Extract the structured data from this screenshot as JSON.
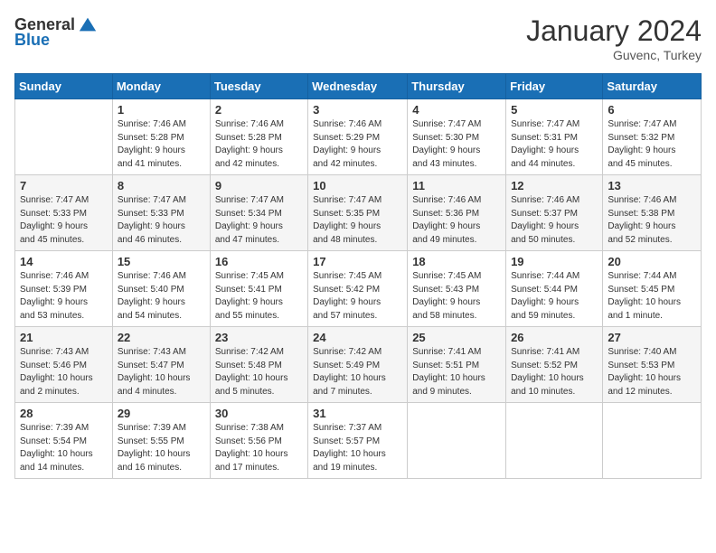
{
  "logo": {
    "general": "General",
    "blue": "Blue"
  },
  "header": {
    "month_year": "January 2024",
    "location": "Guvenc, Turkey"
  },
  "days_of_week": [
    "Sunday",
    "Monday",
    "Tuesday",
    "Wednesday",
    "Thursday",
    "Friday",
    "Saturday"
  ],
  "weeks": [
    [
      {
        "day": "",
        "content": ""
      },
      {
        "day": "1",
        "content": "Sunrise: 7:46 AM\nSunset: 5:28 PM\nDaylight: 9 hours\nand 41 minutes."
      },
      {
        "day": "2",
        "content": "Sunrise: 7:46 AM\nSunset: 5:28 PM\nDaylight: 9 hours\nand 42 minutes."
      },
      {
        "day": "3",
        "content": "Sunrise: 7:46 AM\nSunset: 5:29 PM\nDaylight: 9 hours\nand 42 minutes."
      },
      {
        "day": "4",
        "content": "Sunrise: 7:47 AM\nSunset: 5:30 PM\nDaylight: 9 hours\nand 43 minutes."
      },
      {
        "day": "5",
        "content": "Sunrise: 7:47 AM\nSunset: 5:31 PM\nDaylight: 9 hours\nand 44 minutes."
      },
      {
        "day": "6",
        "content": "Sunrise: 7:47 AM\nSunset: 5:32 PM\nDaylight: 9 hours\nand 45 minutes."
      }
    ],
    [
      {
        "day": "7",
        "content": "Sunrise: 7:47 AM\nSunset: 5:33 PM\nDaylight: 9 hours\nand 45 minutes."
      },
      {
        "day": "8",
        "content": "Sunrise: 7:47 AM\nSunset: 5:33 PM\nDaylight: 9 hours\nand 46 minutes."
      },
      {
        "day": "9",
        "content": "Sunrise: 7:47 AM\nSunset: 5:34 PM\nDaylight: 9 hours\nand 47 minutes."
      },
      {
        "day": "10",
        "content": "Sunrise: 7:47 AM\nSunset: 5:35 PM\nDaylight: 9 hours\nand 48 minutes."
      },
      {
        "day": "11",
        "content": "Sunrise: 7:46 AM\nSunset: 5:36 PM\nDaylight: 9 hours\nand 49 minutes."
      },
      {
        "day": "12",
        "content": "Sunrise: 7:46 AM\nSunset: 5:37 PM\nDaylight: 9 hours\nand 50 minutes."
      },
      {
        "day": "13",
        "content": "Sunrise: 7:46 AM\nSunset: 5:38 PM\nDaylight: 9 hours\nand 52 minutes."
      }
    ],
    [
      {
        "day": "14",
        "content": "Sunrise: 7:46 AM\nSunset: 5:39 PM\nDaylight: 9 hours\nand 53 minutes."
      },
      {
        "day": "15",
        "content": "Sunrise: 7:46 AM\nSunset: 5:40 PM\nDaylight: 9 hours\nand 54 minutes."
      },
      {
        "day": "16",
        "content": "Sunrise: 7:45 AM\nSunset: 5:41 PM\nDaylight: 9 hours\nand 55 minutes."
      },
      {
        "day": "17",
        "content": "Sunrise: 7:45 AM\nSunset: 5:42 PM\nDaylight: 9 hours\nand 57 minutes."
      },
      {
        "day": "18",
        "content": "Sunrise: 7:45 AM\nSunset: 5:43 PM\nDaylight: 9 hours\nand 58 minutes."
      },
      {
        "day": "19",
        "content": "Sunrise: 7:44 AM\nSunset: 5:44 PM\nDaylight: 9 hours\nand 59 minutes."
      },
      {
        "day": "20",
        "content": "Sunrise: 7:44 AM\nSunset: 5:45 PM\nDaylight: 10 hours\nand 1 minute."
      }
    ],
    [
      {
        "day": "21",
        "content": "Sunrise: 7:43 AM\nSunset: 5:46 PM\nDaylight: 10 hours\nand 2 minutes."
      },
      {
        "day": "22",
        "content": "Sunrise: 7:43 AM\nSunset: 5:47 PM\nDaylight: 10 hours\nand 4 minutes."
      },
      {
        "day": "23",
        "content": "Sunrise: 7:42 AM\nSunset: 5:48 PM\nDaylight: 10 hours\nand 5 minutes."
      },
      {
        "day": "24",
        "content": "Sunrise: 7:42 AM\nSunset: 5:49 PM\nDaylight: 10 hours\nand 7 minutes."
      },
      {
        "day": "25",
        "content": "Sunrise: 7:41 AM\nSunset: 5:51 PM\nDaylight: 10 hours\nand 9 minutes."
      },
      {
        "day": "26",
        "content": "Sunrise: 7:41 AM\nSunset: 5:52 PM\nDaylight: 10 hours\nand 10 minutes."
      },
      {
        "day": "27",
        "content": "Sunrise: 7:40 AM\nSunset: 5:53 PM\nDaylight: 10 hours\nand 12 minutes."
      }
    ],
    [
      {
        "day": "28",
        "content": "Sunrise: 7:39 AM\nSunset: 5:54 PM\nDaylight: 10 hours\nand 14 minutes."
      },
      {
        "day": "29",
        "content": "Sunrise: 7:39 AM\nSunset: 5:55 PM\nDaylight: 10 hours\nand 16 minutes."
      },
      {
        "day": "30",
        "content": "Sunrise: 7:38 AM\nSunset: 5:56 PM\nDaylight: 10 hours\nand 17 minutes."
      },
      {
        "day": "31",
        "content": "Sunrise: 7:37 AM\nSunset: 5:57 PM\nDaylight: 10 hours\nand 19 minutes."
      },
      {
        "day": "",
        "content": ""
      },
      {
        "day": "",
        "content": ""
      },
      {
        "day": "",
        "content": ""
      }
    ]
  ]
}
